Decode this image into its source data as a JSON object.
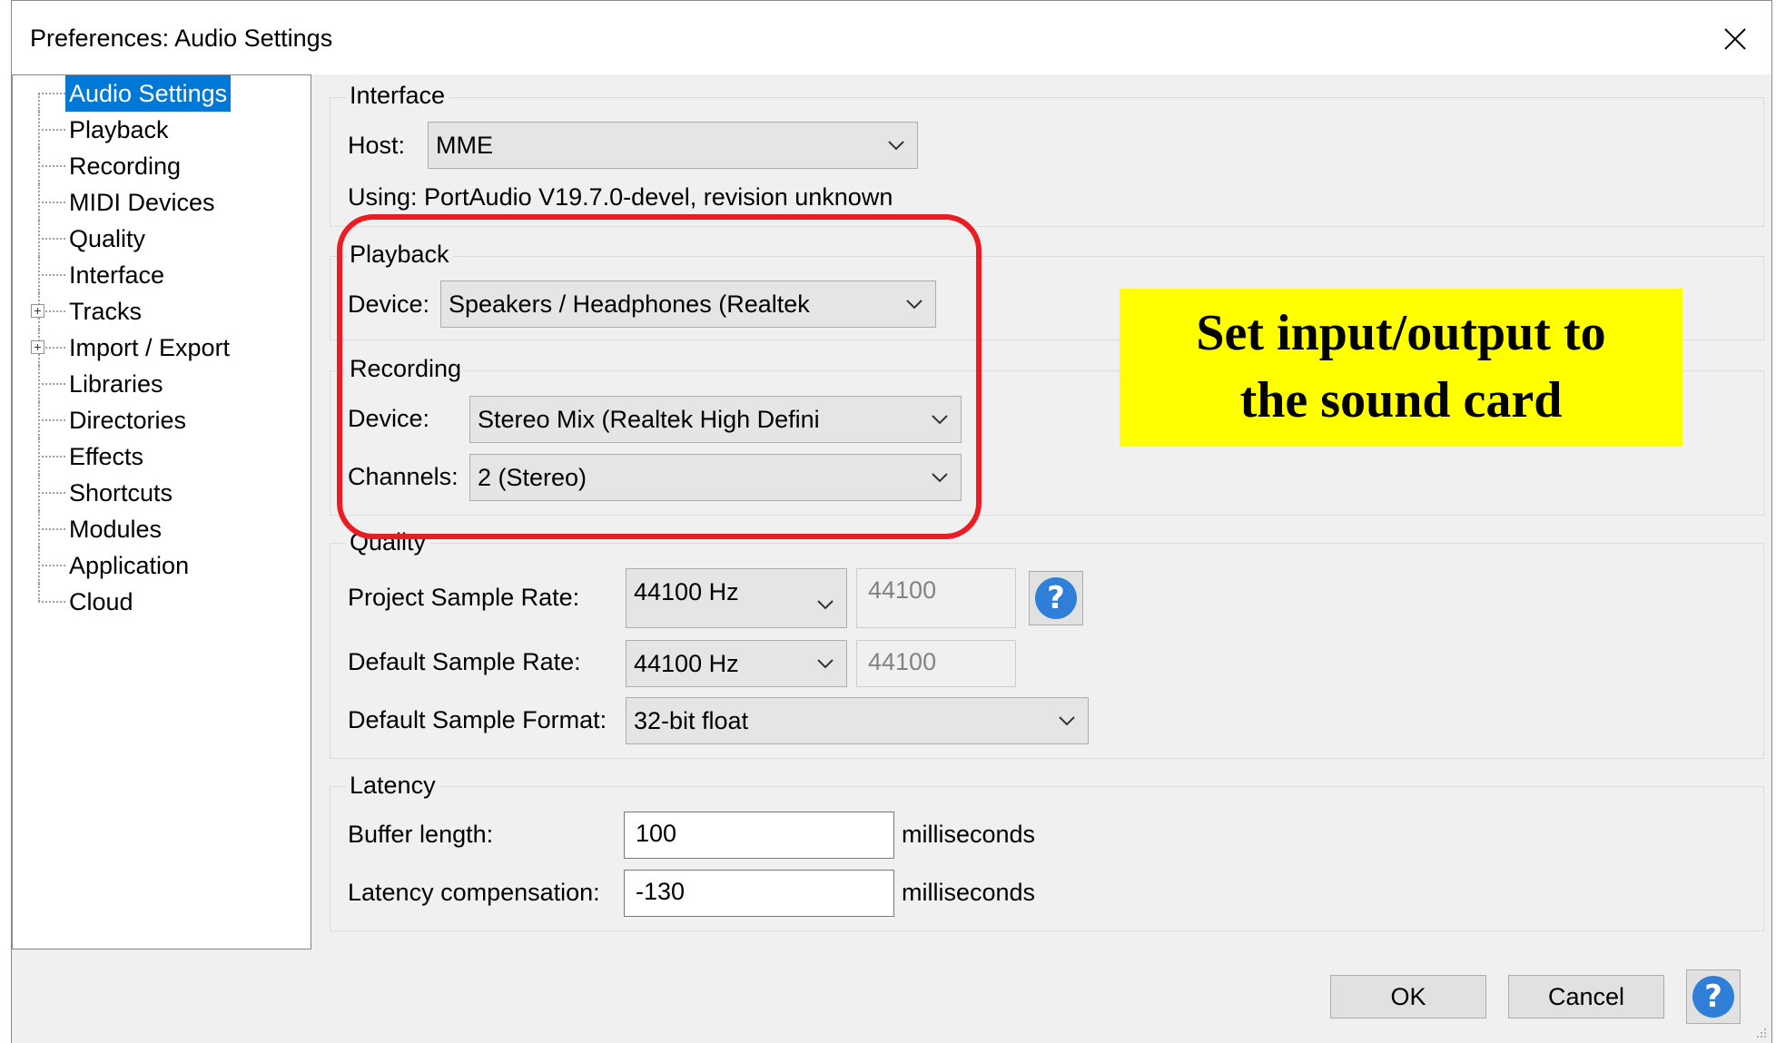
{
  "window": {
    "title": "Preferences: Audio Settings"
  },
  "tree": {
    "items": [
      {
        "label": "Audio Settings",
        "selected": true,
        "expandable": false
      },
      {
        "label": "Playback",
        "expandable": false
      },
      {
        "label": "Recording",
        "expandable": false
      },
      {
        "label": "MIDI Devices",
        "expandable": false
      },
      {
        "label": "Quality",
        "expandable": false
      },
      {
        "label": "Interface",
        "expandable": false
      },
      {
        "label": "Tracks",
        "expandable": true
      },
      {
        "label": "Import / Export",
        "expandable": true
      },
      {
        "label": "Libraries",
        "expandable": false
      },
      {
        "label": "Directories",
        "expandable": false
      },
      {
        "label": "Effects",
        "expandable": false
      },
      {
        "label": "Shortcuts",
        "expandable": false
      },
      {
        "label": "Modules",
        "expandable": false
      },
      {
        "label": "Application",
        "expandable": false
      },
      {
        "label": "Cloud",
        "expandable": false
      }
    ]
  },
  "interface": {
    "group_label": "Interface",
    "host_label": "Host:",
    "host_value": "MME",
    "using_text": "Using: PortAudio V19.7.0-devel, revision unknown"
  },
  "playback": {
    "group_label": "Playback",
    "device_label": "Device:",
    "device_value": "Speakers / Headphones (Realtek"
  },
  "recording": {
    "group_label": "Recording",
    "device_label": "Device:",
    "device_value": "Stereo Mix (Realtek High Defini",
    "channels_label": "Channels:",
    "channels_value": "2 (Stereo)"
  },
  "quality": {
    "group_label": "Quality",
    "project_rate_label": "Project Sample Rate:",
    "project_rate_value": "44100 Hz",
    "project_rate_text": "44100",
    "default_rate_label": "Default Sample Rate:",
    "default_rate_value": "44100 Hz",
    "default_rate_text": "44100",
    "format_label": "Default Sample Format:",
    "format_value": "32-bit float"
  },
  "latency": {
    "group_label": "Latency",
    "buffer_label": "Buffer length:",
    "buffer_value": "100",
    "buffer_unit": "milliseconds",
    "comp_label": "Latency compensation:",
    "comp_value": "-130",
    "comp_unit": "milliseconds"
  },
  "buttons": {
    "ok": "OK",
    "cancel": "Cancel",
    "help_glyph": "?"
  },
  "annotation": {
    "line1": "Set input/output to",
    "line2": "the sound card",
    "highlight_color": "#ffff00",
    "ring_color": "#ea1c24"
  },
  "colors": {
    "selection": "#0078d7",
    "help_blue": "#2f7ed8"
  }
}
